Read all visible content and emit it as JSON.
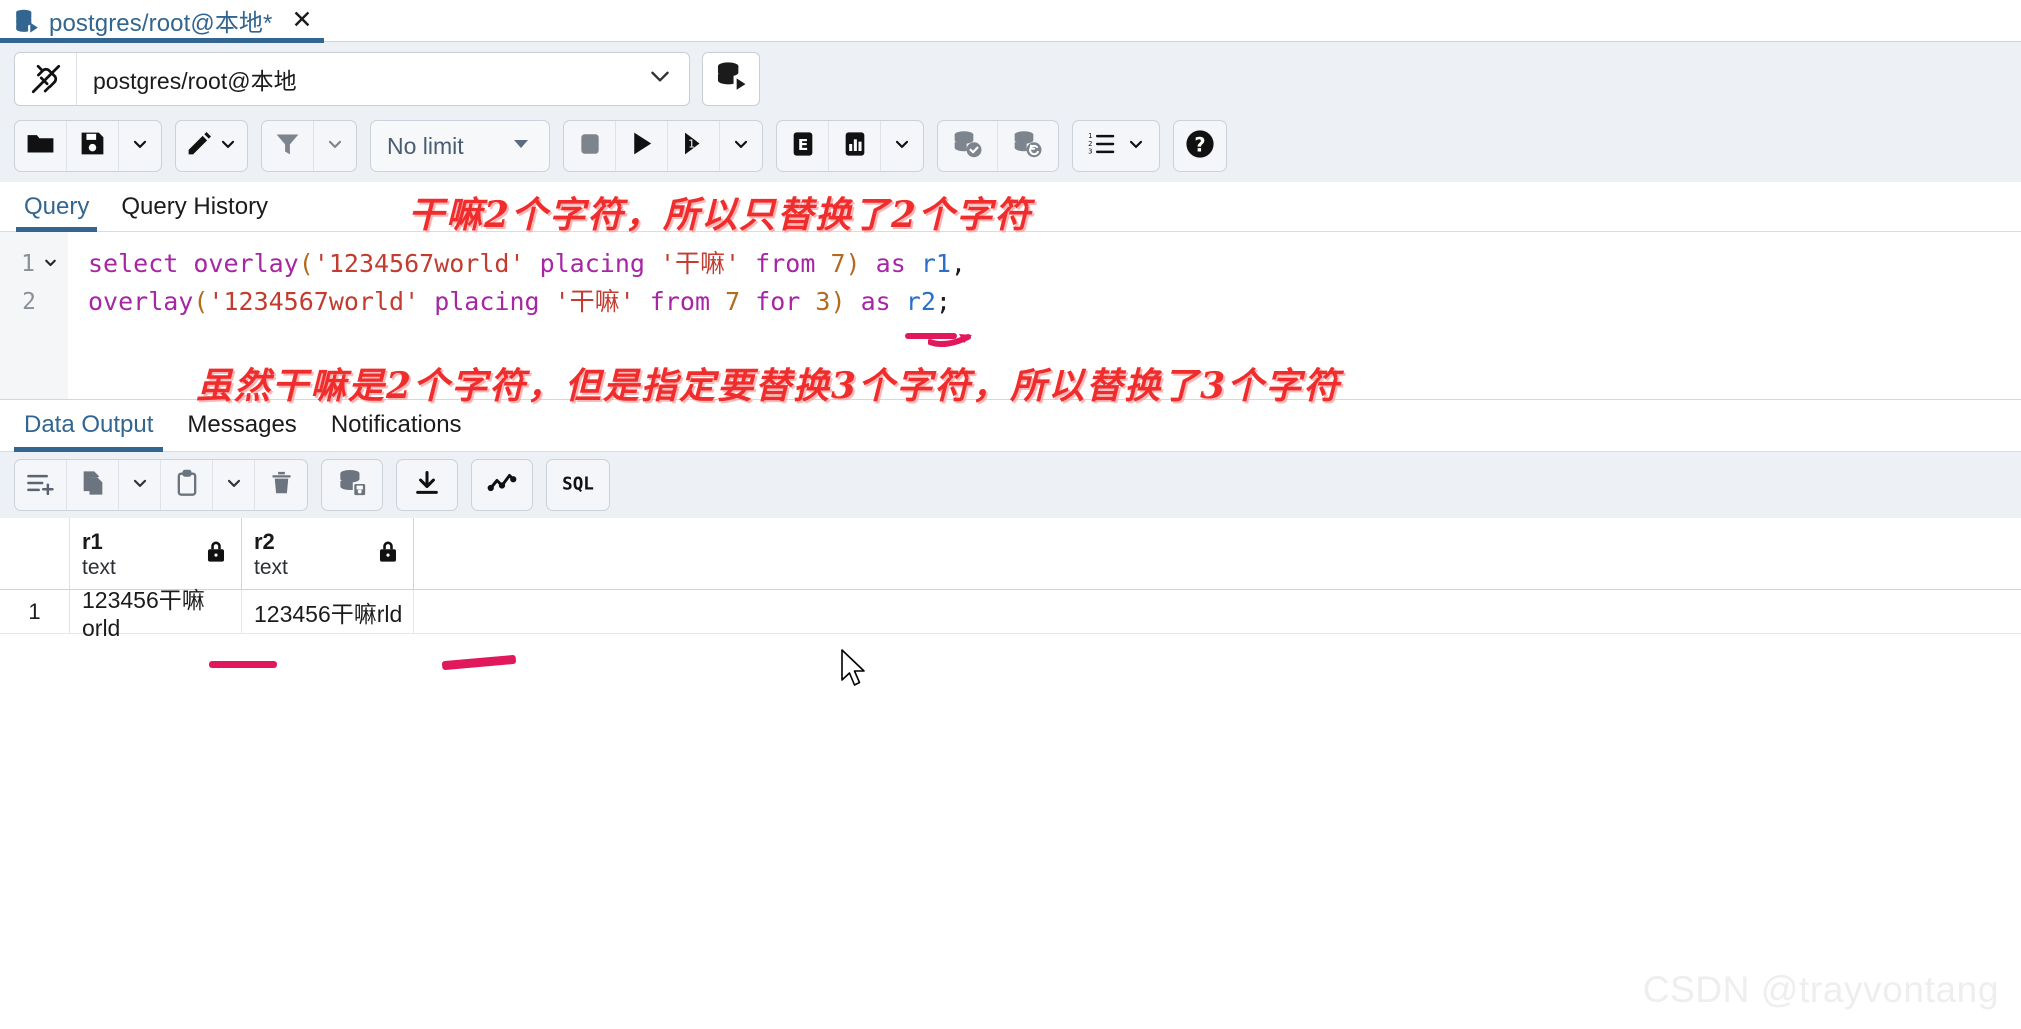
{
  "window": {
    "tab_title": "postgres/root@本地*",
    "tab_close_label": "✕",
    "db_icon": "database-tab-icon"
  },
  "connection_bar": {
    "connect_icon": "disconnect-plug-icon",
    "connection_value": "postgres/root@本地",
    "dropdown_icon": "chevron-down-icon",
    "server_button_icon": "server-connect-icon"
  },
  "toolbar": {
    "groups": [
      {
        "buttons": [
          {
            "name": "open-file-button",
            "icon": "folder-icon"
          },
          {
            "name": "save-file-button",
            "icon": "save-icon"
          },
          {
            "name": "save-file-dropdown",
            "icon": "chevron-down-icon"
          }
        ]
      },
      {
        "buttons": [
          {
            "name": "edit-button",
            "icon": "pencil-icon"
          },
          {
            "name": "edit-dropdown",
            "icon": "chevron-down-icon"
          }
        ]
      },
      {
        "buttons": [
          {
            "name": "filter-button",
            "icon": "filter-icon"
          },
          {
            "name": "filter-dropdown",
            "icon": "chevron-down-icon"
          }
        ]
      },
      {
        "buttons": [
          {
            "name": "row-limit-select",
            "icon": "chevron-down-icon"
          }
        ]
      },
      {
        "buttons": [
          {
            "name": "stop-query-button",
            "icon": "stop-square-icon"
          },
          {
            "name": "execute-query-button",
            "icon": "play-icon"
          },
          {
            "name": "execute-step-button",
            "icon": "play-step-icon"
          },
          {
            "name": "execute-dropdown",
            "icon": "chevron-down-icon"
          }
        ]
      },
      {
        "buttons": [
          {
            "name": "explain-button",
            "icon": "explain-e-icon"
          },
          {
            "name": "explain-analyze-button",
            "icon": "bar-chart-icon"
          },
          {
            "name": "explain-dropdown",
            "icon": "chevron-down-icon"
          }
        ]
      },
      {
        "buttons": [
          {
            "name": "commit-button",
            "icon": "database-check-icon"
          },
          {
            "name": "rollback-button",
            "icon": "database-rollback-icon"
          }
        ]
      },
      {
        "buttons": [
          {
            "name": "macros-button",
            "icon": "numbered-list-icon"
          },
          {
            "name": "macros-dropdown",
            "icon": "chevron-down-icon"
          }
        ]
      },
      {
        "buttons": [
          {
            "name": "help-button",
            "icon": "question-mark-icon"
          }
        ]
      }
    ],
    "row_limit_label": "No limit"
  },
  "query_tabs": [
    {
      "label": "Query",
      "active": true
    },
    {
      "label": "Query History",
      "active": false
    }
  ],
  "editor": {
    "line_numbers": [
      "1",
      "2"
    ],
    "line1": {
      "kw_select": "select",
      "fn_overlay": "overlay",
      "paren_open": "(",
      "str_source": "'1234567world'",
      "kw_placing": "placing",
      "str_replace": "'干嘛'",
      "kw_from": "from",
      "num_from": "7",
      "paren_close": ")",
      "kw_as": "as",
      "alias": "r1",
      "comma": ","
    },
    "line2": {
      "fn_overlay": "overlay",
      "paren_open": "(",
      "str_source": "'1234567world'",
      "kw_placing": "placing",
      "str_replace": "'干嘛'",
      "kw_from": "from",
      "num_from": "7",
      "kw_for": "for",
      "num_for": "3",
      "paren_close": ")",
      "kw_as": "as",
      "alias": "r2",
      "semicolon": ";"
    }
  },
  "annotations": {
    "top": "干嘛2个字符，所以只替换了2个字符",
    "bottom": "虽然干嘛是2个字符，但是指定要替换3个字符，所以替换了3个字符",
    "color": "#ef2d2d",
    "underline_color": "#e2185c"
  },
  "output_tabs": [
    {
      "label": "Data Output",
      "active": true
    },
    {
      "label": "Messages",
      "active": false
    },
    {
      "label": "Notifications",
      "active": false
    }
  ],
  "output_toolbar": {
    "buttons": [
      {
        "name": "add-row-button",
        "icon": "add-row-icon"
      },
      {
        "name": "copy-button",
        "icon": "copy-icon"
      },
      {
        "name": "copy-dropdown",
        "icon": "chevron-down-icon"
      },
      {
        "name": "paste-button",
        "icon": "paste-clipboard-icon"
      },
      {
        "name": "paste-dropdown",
        "icon": "chevron-down-icon"
      },
      {
        "name": "delete-row-button",
        "icon": "trash-icon"
      },
      {
        "name": "save-data-button",
        "icon": "database-save-icon"
      },
      {
        "name": "download-csv-button",
        "icon": "download-icon"
      },
      {
        "name": "graph-visualiser-button",
        "icon": "line-graph-icon"
      },
      {
        "name": "query-tool-sql-button",
        "icon": "sql-text-icon"
      }
    ]
  },
  "grid": {
    "columns": [
      {
        "name": "r1",
        "type": "text",
        "locked": true
      },
      {
        "name": "r2",
        "type": "text",
        "locked": true
      }
    ],
    "rows": [
      {
        "num": "1",
        "cells": [
          "123456干嘛orld",
          "123456干嘛rld"
        ]
      }
    ]
  },
  "watermark": "CSDN @trayvontang",
  "colors": {
    "accent": "#326690",
    "toolbar_bg": "#edf0f5",
    "annotation_red": "#ef2d2d",
    "keyword_purple": "#a626a4",
    "string_red": "#c23c30",
    "number_orange": "#b26b20",
    "identifier_blue": "#2a6fc9"
  }
}
